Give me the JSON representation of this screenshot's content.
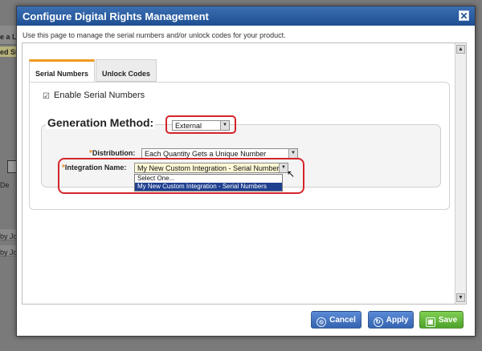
{
  "background": {
    "fragments": [
      "e a L",
      "ed St",
      "De",
      "by Jo",
      "by Jo"
    ]
  },
  "dialog": {
    "title": "Configure Digital Rights Management",
    "instructions": "Use this page to manage the serial numbers and/or unlock codes for your product."
  },
  "tabs": [
    {
      "label": "Serial Numbers",
      "active": true
    },
    {
      "label": "Unlock Codes",
      "active": false
    }
  ],
  "serial_panel": {
    "enable_label": "Enable Serial Numbers",
    "enable_checked": true,
    "generation_method_label": "Generation Method:",
    "generation_method_value": "External",
    "distribution_label": "Distribution:",
    "distribution_value": "Each Quantity Gets a Unique Number",
    "integration_label": "Integration Name:",
    "integration_value": "My New Custom Integration - Serial Numbers",
    "integration_options": [
      "Select One...",
      "My New Custom Integration - Serial Numbers"
    ],
    "required_marker": "*"
  },
  "footer": {
    "cancel_label": "Cancel",
    "apply_label": "Apply",
    "save_label": "Save"
  },
  "colors": {
    "titlebar": "#2a5ca3",
    "active_tab_accent": "#f29a1f",
    "highlight_ring": "#d4242a",
    "button_blue": "#3f6fbf",
    "button_green": "#5cb336"
  }
}
